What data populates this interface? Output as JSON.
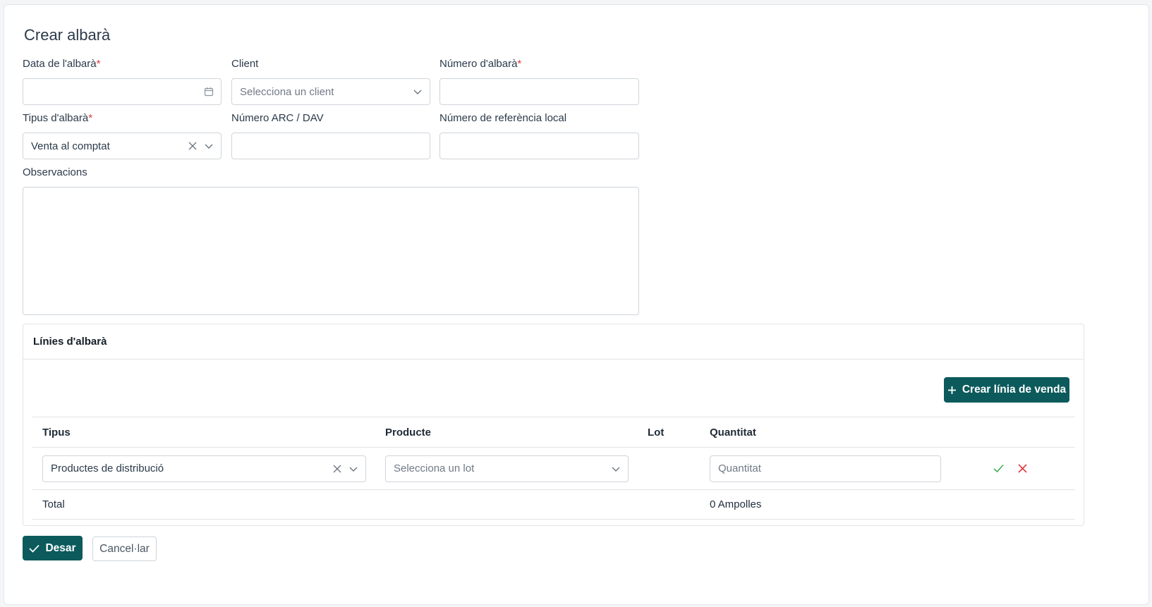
{
  "title": "Crear albarà",
  "form": {
    "date": {
      "label": "Data de l'albarà",
      "required_mark": "*",
      "value": ""
    },
    "client": {
      "label": "Client",
      "placeholder": "Selecciona un client"
    },
    "number": {
      "label": "Número d'albarà",
      "required_mark": "*",
      "value": ""
    },
    "type": {
      "label": "Tipus d'albarà",
      "required_mark": "*",
      "value": "Venta al comptat"
    },
    "arc": {
      "label": "Número ARC / DAV",
      "value": ""
    },
    "local_ref": {
      "label": "Número de referència local",
      "value": ""
    },
    "observations": {
      "label": "Observacions",
      "value": ""
    }
  },
  "lines": {
    "title": "Línies d'albarà",
    "create_button": "Crear línia de venda",
    "columns": [
      "Tipus",
      "Producte",
      "Lot",
      "Quantitat"
    ],
    "row": {
      "type": "Productes de distribució",
      "product_placeholder": "Selecciona un lot",
      "quantity_placeholder": "Quantitat"
    },
    "total": {
      "label": "Total",
      "value": "0 Ampolles"
    }
  },
  "actions": {
    "save": "Desar",
    "cancel": "Cancel·lar"
  },
  "colors": {
    "primary": "#0c5a5c",
    "required": "#e0383e",
    "confirm": "#3fae5b",
    "delete": "#e0383e"
  },
  "icons": [
    "calendar-icon",
    "chevron-down-icon",
    "clear-icon",
    "plus-icon",
    "check-icon",
    "close-icon"
  ]
}
